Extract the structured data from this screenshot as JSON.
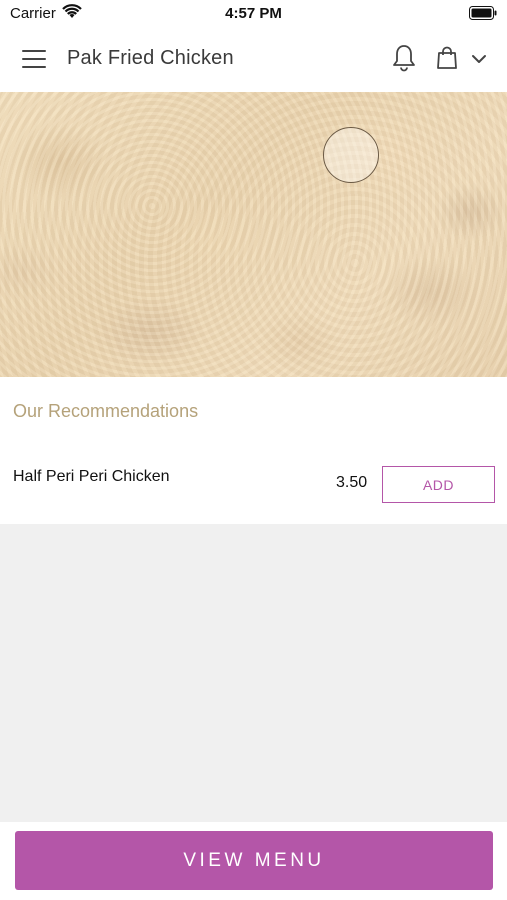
{
  "status_bar": {
    "carrier": "Carrier",
    "time": "4:57 PM"
  },
  "header": {
    "title": "Pak Fried Chicken",
    "icons": [
      "menu-icon",
      "bell-icon",
      "shopping-bag-icon",
      "chevron-down-icon"
    ]
  },
  "recommendations": {
    "title": "Our Recommendations",
    "items": [
      {
        "name": "Half Peri Peri Chicken",
        "price": "3.50",
        "add_label": "ADD"
      }
    ]
  },
  "footer": {
    "view_menu_label": "VIEW MENU"
  },
  "colors": {
    "accent": "#b456a8",
    "section_title": "#b5a27a",
    "background": "#f0f0f0"
  }
}
